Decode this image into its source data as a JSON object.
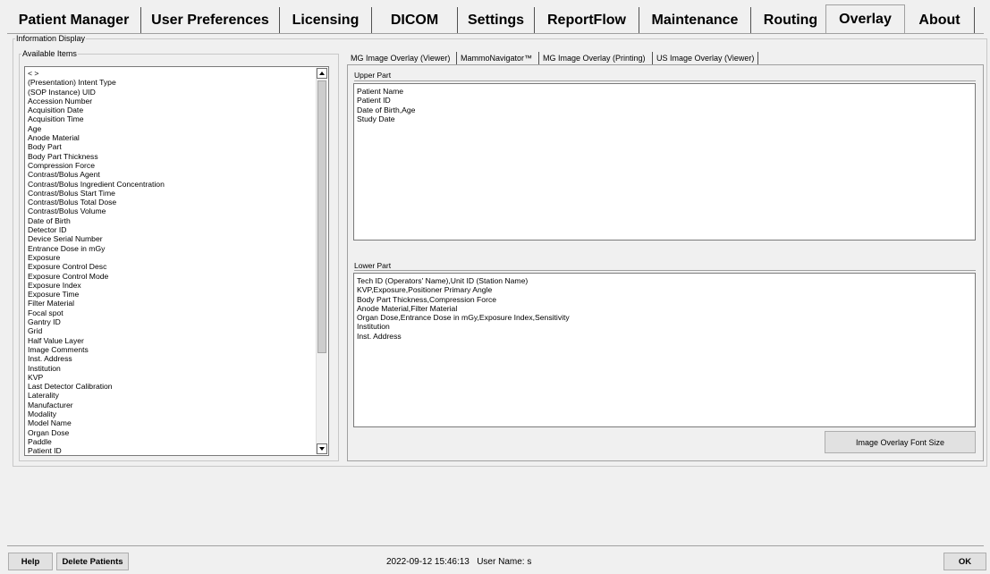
{
  "top_tabs": [
    {
      "label": "Patient Manager"
    },
    {
      "label": "User Preferences"
    },
    {
      "label": "Licensing"
    },
    {
      "label": "DICOM"
    },
    {
      "label": "Settings"
    },
    {
      "label": "ReportFlow"
    },
    {
      "label": "Maintenance"
    },
    {
      "label": "Routing"
    },
    {
      "label": "Overlay"
    },
    {
      "label": "About"
    }
  ],
  "active_top_tab": "Overlay",
  "info_display": {
    "legend": "Information Display",
    "available_items": {
      "legend": "Available Items",
      "items": [
        "< >",
        "(Presentation) Intent Type",
        "(SOP Instance) UID",
        "Accession Number",
        "Acquisition Date",
        "Acquisition Time",
        "Age",
        "Anode Material",
        "Body Part",
        "Body Part Thickness",
        "Compression Force",
        "Contrast/Bolus Agent",
        "Contrast/Bolus Ingredient Concentration",
        "Contrast/Bolus Start Time",
        "Contrast/Bolus Total Dose",
        "Contrast/Bolus Volume",
        "Date of Birth",
        "Detector ID",
        "Device Serial Number",
        "Entrance Dose in mGy",
        "Exposure",
        "Exposure Control Desc",
        "Exposure Control Mode",
        "Exposure Index",
        "Exposure Time",
        "Filter Material",
        "Focal spot",
        "Gantry ID",
        "Grid",
        "Half Value Layer",
        "Image Comments",
        "Inst. Address",
        "Institution",
        "KVP",
        "Last Detector Calibration",
        "Laterality",
        "Manufacturer",
        "Modality",
        "Model Name",
        "Organ Dose",
        "Paddle",
        "Patient ID"
      ]
    },
    "overlay_tabs": [
      {
        "label": "MG Image Overlay (Viewer)"
      },
      {
        "label": "MammoNavigator™"
      },
      {
        "label": "MG Image Overlay (Printing)"
      },
      {
        "label": "US Image Overlay (Viewer)"
      }
    ],
    "active_overlay_tab": "MG Image Overlay (Printing)",
    "upper_part": {
      "label": "Upper Part",
      "lines": [
        "Patient Name",
        "Patient ID",
        "Date of Birth,Age",
        "Study Date"
      ]
    },
    "lower_part": {
      "label": "Lower Part",
      "lines": [
        "Tech ID (Operators' Name),Unit ID (Station Name)",
        "KVP,Exposure,Positioner Primary Angle",
        "Body Part Thickness,Compression Force",
        "Anode Material,Filter Material",
        "Organ Dose,Entrance Dose in mGy,Exposure Index,Sensitivity",
        "Institution",
        "Inst. Address"
      ]
    },
    "font_size_button": "Image Overlay Font Size"
  },
  "footer": {
    "help_button": "Help",
    "delete_patients_button": "Delete Patients",
    "timestamp": "2022-09-12 15:46:13",
    "user_name_label": "User Name:",
    "user_name": "s",
    "ok_button": "OK"
  }
}
